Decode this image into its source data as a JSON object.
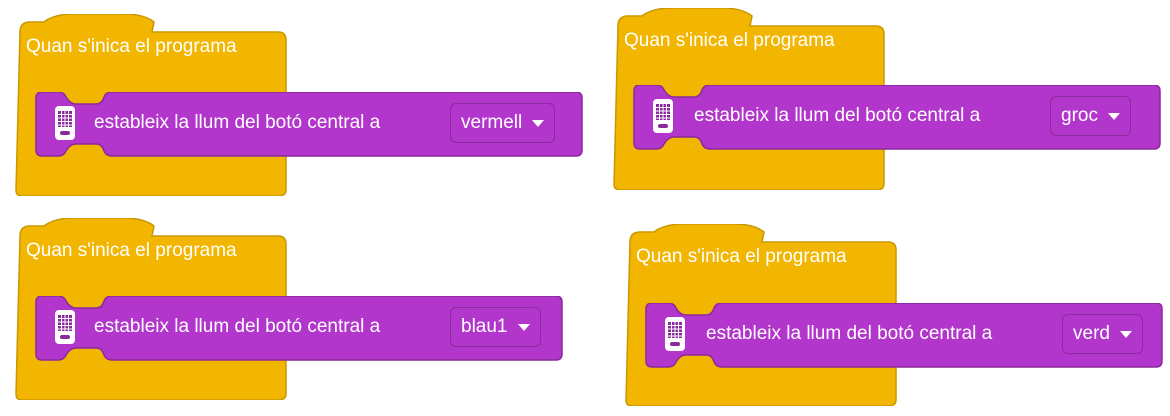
{
  "colors": {
    "event_block": "#f2b600",
    "event_block_border": "#c99700",
    "light_block": "#b235cc",
    "light_block_border": "#8a2a9c"
  },
  "scripts": [
    {
      "hat_label": "Quan s'inica el programa",
      "command_label": "estableix la llum del botó central a",
      "dropdown_value": "vermell",
      "icon": "hub-icon"
    },
    {
      "hat_label": "Quan s'inica el programa",
      "command_label": "estableix la llum del botó central a",
      "dropdown_value": "groc",
      "icon": "hub-icon"
    },
    {
      "hat_label": "Quan s'inica el programa",
      "command_label": "estableix la llum del botó central a",
      "dropdown_value": "blau1",
      "icon": "hub-icon"
    },
    {
      "hat_label": "Quan s'inica el programa",
      "command_label": "estableix la llum del botó central a",
      "dropdown_value": "verd",
      "icon": "hub-icon"
    }
  ]
}
